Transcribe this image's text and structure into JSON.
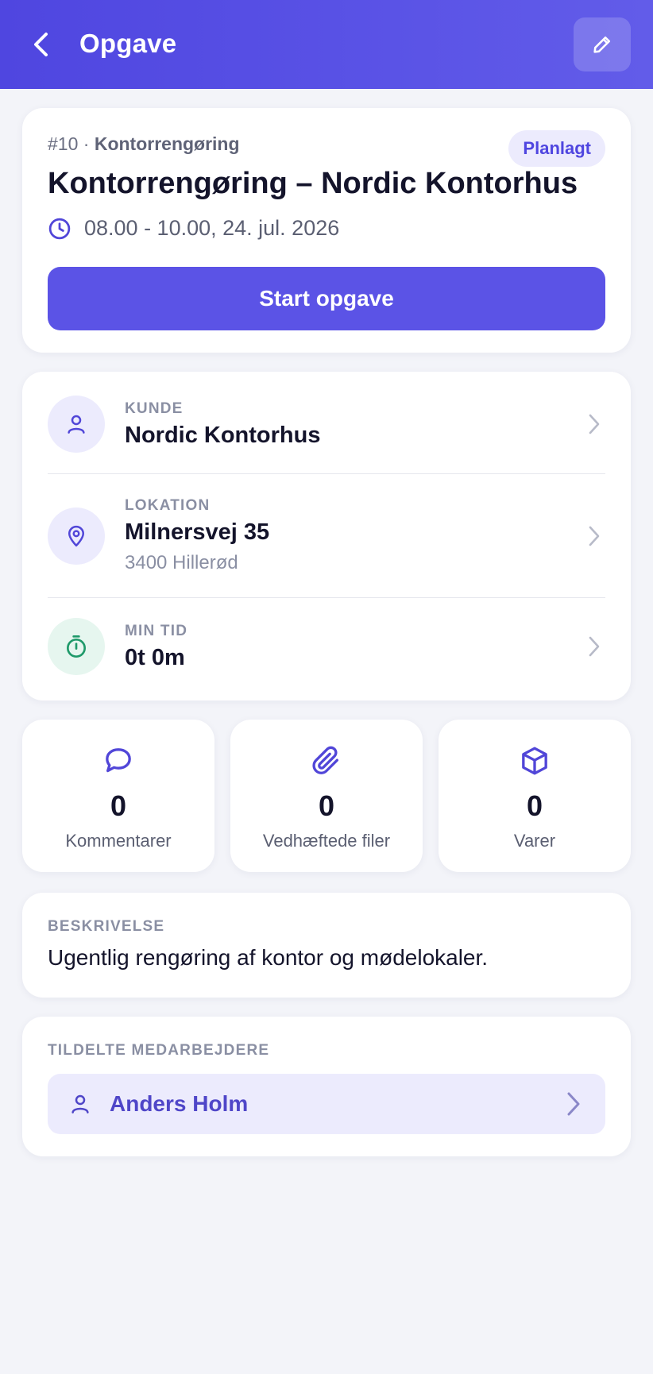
{
  "header": {
    "title": "Opgave",
    "back_icon": "chevron-left-icon",
    "edit_icon": "pencil-icon",
    "gradient_colors": [
      "#4f46e0",
      "#625ce9"
    ]
  },
  "task": {
    "number": "#10",
    "separator": "·",
    "category": "Kontorrengøring",
    "status": "Planlagt",
    "title": "Kontorrengøring – Nordic Kontorhus",
    "time": "08.00 - 10.00, 24. jul. 2026",
    "start_button": "Start opgave"
  },
  "details": {
    "customer": {
      "label": "KUNDE",
      "value": "Nordic Kontorhus"
    },
    "location": {
      "label": "LOKATION",
      "value": "Milnersvej 35",
      "sub": "3400 Hillerød"
    },
    "time": {
      "label": "MIN TID",
      "value": "0t 0m"
    }
  },
  "stats": [
    {
      "icon": "comment-icon",
      "count": "0",
      "label": "Kommentarer"
    },
    {
      "icon": "paperclip-icon",
      "count": "0",
      "label": "Vedhæftede filer"
    },
    {
      "icon": "box-icon",
      "count": "0",
      "label": "Varer"
    }
  ],
  "description": {
    "label": "BESKRIVELSE",
    "text": "Ugentlig rengøring af kontor og mødelokaler."
  },
  "assigned": {
    "label": "TILDELTE MEDARBEJDERE",
    "employees": [
      {
        "name": "Anders Holm"
      }
    ]
  },
  "colors": {
    "accent": "#5b53e6",
    "accent_light": "#ecebfd",
    "success": "#1f9a6a",
    "success_light": "#e6f6ef",
    "background": "#f3f4f9"
  }
}
